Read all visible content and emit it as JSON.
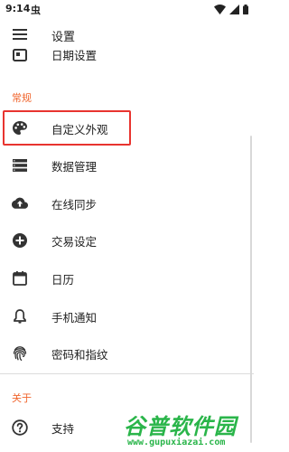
{
  "status_bar": {
    "time": "9:14",
    "notification_glyph": "虫",
    "icons": [
      "wifi-icon",
      "signal-icon",
      "battery-icon"
    ]
  },
  "app_bar": {
    "title": "设置",
    "menu_icon": "menu-icon"
  },
  "top_item": {
    "label": "日期设置",
    "icon": "calendar-square-icon"
  },
  "sections": {
    "general": {
      "header": "常规",
      "items": [
        {
          "label": "自定义外观",
          "icon": "palette-icon"
        },
        {
          "label": "数据管理",
          "icon": "storage-list-icon"
        },
        {
          "label": "在线同步",
          "icon": "cloud-upload-icon"
        },
        {
          "label": "交易设定",
          "icon": "add-circle-icon"
        },
        {
          "label": "日历",
          "icon": "calendar-icon"
        },
        {
          "label": "手机通知",
          "icon": "bell-icon"
        },
        {
          "label": "密码和指纹",
          "icon": "fingerprint-icon"
        }
      ]
    },
    "about": {
      "header": "关于",
      "items": [
        {
          "label": "支持",
          "icon": "help-circle-icon"
        }
      ]
    }
  },
  "watermark": {
    "title": "谷普软件园",
    "url": "www.gupuxiazai.com"
  },
  "colors": {
    "section_header": "#f0652d",
    "highlight_border": "#e8342f",
    "icon": "#333333",
    "watermark": "#2ab54a"
  }
}
